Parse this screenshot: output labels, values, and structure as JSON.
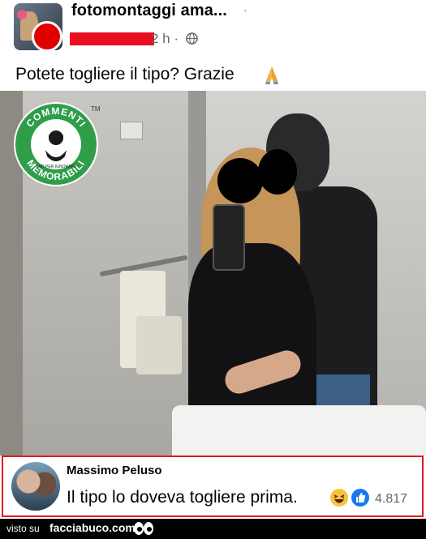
{
  "post": {
    "group_name": "fotomontaggi ama...",
    "more_indicator": "·",
    "time": "2 h ·",
    "icons": {
      "privacy": "globe-icon",
      "caption_emoji": "praying-hands-icon"
    },
    "caption": "Potete togliere il tipo? Grazie"
  },
  "watermark": {
    "top_text": "COMMENTI",
    "bottom_text": "MEMORABILI",
    "center_text": "NATI PER IGNORARE",
    "tm": "TM",
    "colors": {
      "green": "#2e9e4a",
      "dark": "#1a1a1a"
    }
  },
  "comment": {
    "author": "Massimo Peluso",
    "text": "Il tipo lo doveva togliere prima.",
    "reaction_count": "4.817",
    "icons": {
      "reaction_1": "laughing-face-icon",
      "reaction_2": "like-thumb-icon"
    },
    "border_color": "#e0171f"
  },
  "footer": {
    "prefix": "visto su",
    "site": "facciabuco.com",
    "icon": "eyes-icon"
  }
}
